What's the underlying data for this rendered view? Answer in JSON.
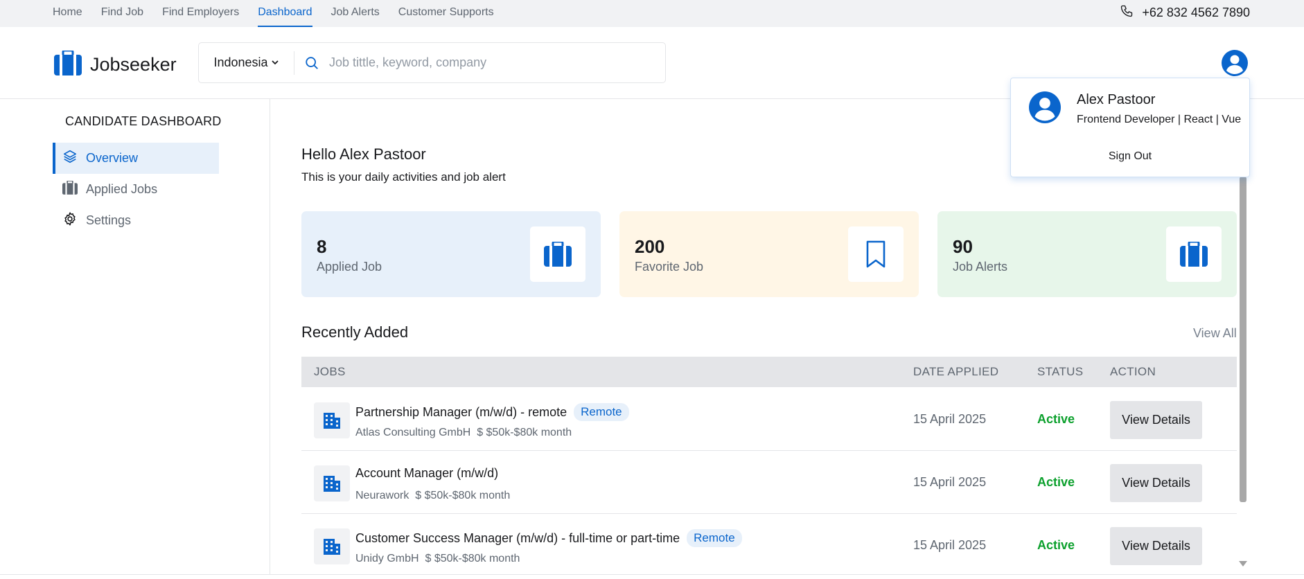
{
  "topnav": {
    "items": [
      "Home",
      "Find Job",
      "Find Employers",
      "Dashboard",
      "Job Alerts",
      "Customer Supports"
    ],
    "active": "Dashboard",
    "phone": "+62 832 4562 7890"
  },
  "header": {
    "brand": "Jobseeker",
    "country": "Indonesia",
    "search_placeholder": "Job tittle, keyword, company"
  },
  "sidebar": {
    "title": "CANDIDATE DASHBOARD",
    "items": [
      {
        "label": "Overview",
        "icon": "layers-icon",
        "active": true
      },
      {
        "label": "Applied Jobs",
        "icon": "briefcase-icon",
        "active": false
      },
      {
        "label": "Settings",
        "icon": "gear-icon",
        "active": false
      }
    ]
  },
  "main": {
    "greeting": "Hello Alex Pastoor",
    "subtitle": "This is your daily activities and job alert",
    "stats": [
      {
        "value": "8",
        "label": "Applied Job",
        "bg": "#e7f0fa",
        "icon": "briefcase-icon"
      },
      {
        "value": "200",
        "label": "Favorite Job",
        "bg": "#fff6e6",
        "icon": "bookmark-icon"
      },
      {
        "value": "90",
        "label": "Job Alerts",
        "bg": "#e7f6ea",
        "icon": "briefcase-icon"
      }
    ],
    "recent_title": "Recently Added",
    "view_all": "View All",
    "columns": [
      "JOBS",
      "DATE APPLIED",
      "STATUS",
      "ACTION"
    ],
    "rows": [
      {
        "title": "Partnership Manager (m/w/d) - remote",
        "tag": "Remote",
        "company": "Atlas Consulting GmbH",
        "salary": "$ $50k-$80k month",
        "date": "15 April 2025",
        "status": "Active",
        "action": "View Details"
      },
      {
        "title": "Account Manager (m/w/d)",
        "tag": "",
        "company": "Neurawork",
        "salary": "$ $50k-$80k month",
        "date": "15 April 2025",
        "status": "Active",
        "action": "View Details"
      },
      {
        "title": "Customer Success Manager (m/w/d) - full-time or part-time",
        "tag": "Remote",
        "company": "Unidy GmbH",
        "salary": "$ $50k-$80k month",
        "date": "15 April 2025",
        "status": "Active",
        "action": "View Details"
      }
    ]
  },
  "profile_menu": {
    "name": "Alex Pastoor",
    "role": "Frontend Developer | React | Vue",
    "sign_out": "Sign Out"
  },
  "colors": {
    "accent": "#0a65cc",
    "status_active": "#0ba02c"
  }
}
